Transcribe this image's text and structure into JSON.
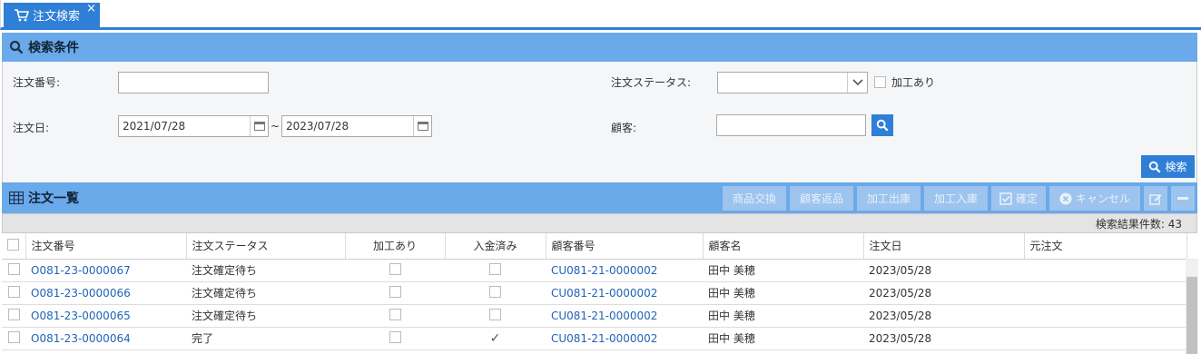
{
  "tab": {
    "label": "注文検索",
    "close": "×"
  },
  "search_panel": {
    "title": "検索条件",
    "order_number_label": "注文番号:",
    "order_number_value": "",
    "order_status_label": "注文ステータス:",
    "order_status_value": "",
    "processing_label": "加工あり",
    "order_date_label": "注文日:",
    "date_from": "2021/07/28",
    "date_to": "2023/07/28",
    "tilde": "~",
    "customer_label": "顧客:",
    "customer_value": "",
    "search_button": "検索"
  },
  "list_panel": {
    "title": "注文一覧",
    "buttons": {
      "exchange": "商品交換",
      "customer_return": "顧客返品",
      "process_out": "加工出庫",
      "process_in": "加工入庫",
      "confirm": "確定",
      "cancel": "キャンセル"
    },
    "result_count_label": "検索結果件数:",
    "result_count": "43"
  },
  "table": {
    "headers": [
      "注文番号",
      "注文ステータス",
      "加工あり",
      "入金済み",
      "顧客番号",
      "顧客名",
      "注文日",
      "元注文"
    ],
    "rows": [
      {
        "order_no": "O081-23-0000067",
        "status": "注文確定待ち",
        "processing": false,
        "paid": false,
        "customer_no": "CU081-21-0000002",
        "customer_name": "田中 美穂",
        "order_date": "2023/05/28",
        "original": ""
      },
      {
        "order_no": "O081-23-0000066",
        "status": "注文確定待ち",
        "processing": false,
        "paid": false,
        "customer_no": "CU081-21-0000002",
        "customer_name": "田中 美穂",
        "order_date": "2023/05/28",
        "original": ""
      },
      {
        "order_no": "O081-23-0000065",
        "status": "注文確定待ち",
        "processing": false,
        "paid": false,
        "customer_no": "CU081-21-0000002",
        "customer_name": "田中 美穂",
        "order_date": "2023/05/28",
        "original": ""
      },
      {
        "order_no": "O081-23-0000064",
        "status": "完了",
        "processing": false,
        "paid": true,
        "customer_no": "CU081-21-0000002",
        "customer_name": "田中 美穂",
        "order_date": "2023/05/28",
        "original": ""
      }
    ]
  },
  "colors": {
    "accent": "#2f7fd6",
    "panel_header": "#6aa9ea",
    "link": "#1f63b8"
  }
}
